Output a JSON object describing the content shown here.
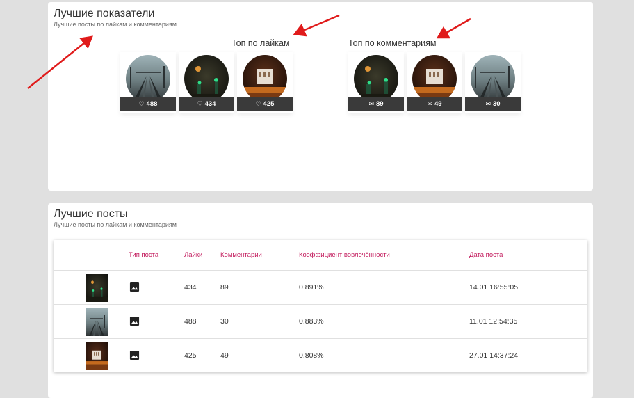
{
  "top_card": {
    "title": "Лучшие показатели",
    "subtitle": "Лучшие посты по лайкам и комментариям",
    "likes_group": {
      "title": "Топ по лайкам",
      "items": [
        {
          "photo": "rails-fog",
          "icon": "heart-icon",
          "value": "488"
        },
        {
          "photo": "night-green",
          "icon": "heart-icon",
          "value": "434"
        },
        {
          "photo": "building-night",
          "icon": "heart-icon",
          "value": "425"
        }
      ]
    },
    "comments_group": {
      "title": "Топ по комментариям",
      "items": [
        {
          "photo": "night-green",
          "icon": "mail-icon",
          "value": "89"
        },
        {
          "photo": "building-night",
          "icon": "mail-icon",
          "value": "49"
        },
        {
          "photo": "rails-fog",
          "icon": "mail-icon",
          "value": "30"
        }
      ]
    }
  },
  "posts_card": {
    "title": "Лучшие посты",
    "subtitle": "Лучшие посты по лайкам и комментариям",
    "columns": [
      "Тип поста",
      "Лайки",
      "Комментарии",
      "Коэффициент вовлечённости",
      "Дата поста"
    ],
    "rows": [
      {
        "photo": "night-green",
        "type_icon": "image-icon",
        "likes": "434",
        "comments": "89",
        "engagement": "0.891%",
        "date": "14.01 16:55:05"
      },
      {
        "photo": "rails-fog",
        "type_icon": "image-icon",
        "likes": "488",
        "comments": "30",
        "engagement": "0.883%",
        "date": "11.01 12:54:35"
      },
      {
        "photo": "building-night",
        "type_icon": "image-icon",
        "likes": "425",
        "comments": "49",
        "engagement": "0.808%",
        "date": "27.01 14:37:24"
      }
    ]
  },
  "colors": {
    "page_bg": "#e0e0e0",
    "header_text": "#c2185b",
    "stat_bar": "#3a3a3a",
    "annotation_arrow": "#e01b1b"
  }
}
